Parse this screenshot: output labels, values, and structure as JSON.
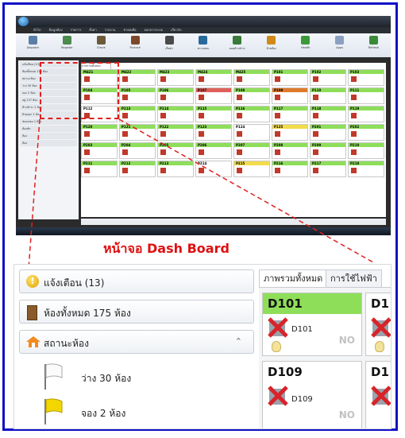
{
  "caption": "หน้าจอ Dash Board",
  "colors": {
    "border": "#1010c8",
    "annotation_red": "#e01010",
    "room_vacant": "#8ede5a",
    "room_booked": "#f2dc4c",
    "room_occupied": "#e07a2a",
    "room_repair": "#e0605a"
  },
  "screenshot": {
    "menu_tabs": [
      "ทั่วไป",
      "ข้อมูลห้อง",
      "รายการ",
      "ตั้งค่า",
      "รายงาน",
      "ช่วยเหลือ",
      "ออกจากระบบ",
      "เกี่ยวกับ"
    ],
    "ribbon_buttons": [
      "Dispatch",
      "Register",
      "Check",
      "Finance",
      "เซ็ตค่า",
      "ตรวจสอบ",
      "ยอดค้างชำระ",
      "ย้ายห้อง",
      "Health",
      "Apps",
      "Refresh"
    ],
    "left_items": [
      "แจ้งเตือน (13)",
      "ห้องทั้งหมด 175 ห้อง",
      "สถานะห้อง",
      "ว่าง 30 ห้อง",
      "จอง 2 ห้อง",
      "อยู่ 137 ห้อง",
      "ค้างชำระ 1 ห้อง",
      "ย้ายออก 1 ห้อง",
      "ซ่อมแซม 1 ห้อง",
      "ห้องพัก",
      "ห้อง",
      "ห้อง"
    ],
    "grid_tab": "ภาพรวมทั้งหมด",
    "rooms": [
      "M421",
      "M422",
      "M423",
      "M424",
      "M425",
      "P101",
      "P102",
      "P103",
      "P104",
      "P105",
      "P106",
      "P107",
      "P108",
      "P109",
      "P110",
      "P111",
      "P112",
      "P113",
      "P114",
      "P115",
      "P116",
      "P117",
      "P118",
      "P119",
      "P120",
      "P121",
      "P122",
      "P123",
      "P124",
      "P125",
      "P201",
      "P202",
      "P203",
      "P204",
      "P205",
      "P206",
      "P207",
      "P208",
      "P209",
      "P210",
      "P211",
      "P212",
      "P213",
      "P214",
      "P215",
      "P216",
      "P217",
      "P218"
    ],
    "red_rooms": [
      11
    ],
    "orange_rooms": [
      13
    ],
    "yellow_rooms": [
      29,
      44
    ],
    "white_rooms": [
      16,
      28,
      43
    ],
    "bottom_fields": [
      "ทั้งหมด",
      "0",
      "0",
      "ติดต่อ 1",
      "ติดต่อ 2"
    ],
    "statusbar": "Commercial Version 2.0"
  },
  "zoom": {
    "sidebar": {
      "alerts_label": "แจ้งเตือน (13)",
      "all_rooms_label": "ห้องทั้งหมด 175 ห้อง",
      "status_label": "สถานะห้อง",
      "vacant_label": "ว่าง 30 ห้อง",
      "booked_label": "จอง 2 ห้อง"
    },
    "tabs": [
      "ภาพรวมทั้งหมด",
      "การใช้ไฟฟ้า"
    ],
    "rooms": [
      {
        "code": "D101",
        "label": "D101",
        "status": "NO"
      },
      {
        "code": "D1",
        "label": ""
      },
      {
        "code": "D109",
        "label": "D109",
        "status": "NO"
      },
      {
        "code": "D1",
        "label": ""
      }
    ]
  }
}
